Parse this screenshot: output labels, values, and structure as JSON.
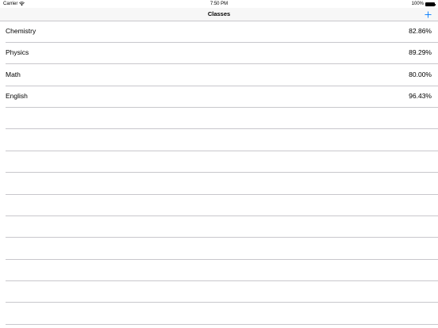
{
  "status_bar": {
    "carrier": "Carrier",
    "time": "7:50 PM",
    "battery": "100%"
  },
  "nav": {
    "title": "Classes",
    "add_icon": "plus-icon",
    "accent_color": "#007aff"
  },
  "classes": [
    {
      "name": "Chemistry",
      "grade": "82.86%"
    },
    {
      "name": "Physics",
      "grade": "89.29%"
    },
    {
      "name": "Math",
      "grade": "80.00%"
    },
    {
      "name": "English",
      "grade": "96.43%"
    }
  ]
}
